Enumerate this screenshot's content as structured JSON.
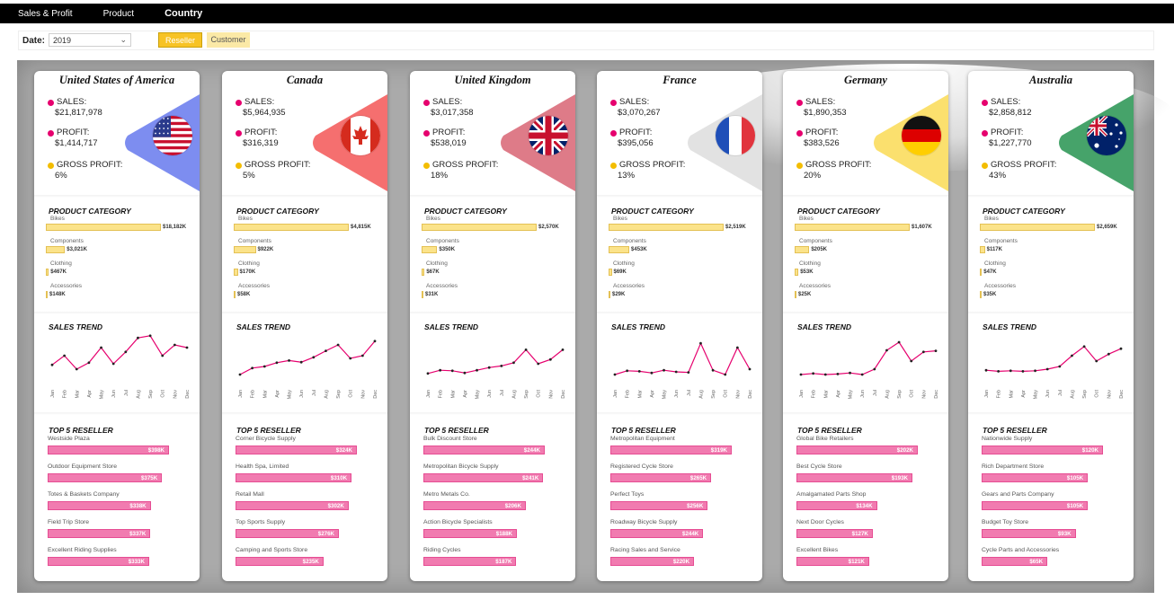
{
  "nav": {
    "tabs": [
      {
        "label": "Sales & Profit"
      },
      {
        "label": "Product"
      },
      {
        "label": "Country"
      }
    ],
    "active": "Country"
  },
  "filters": {
    "date_label": "Date:",
    "date_value": "2019",
    "reseller_label": "Reseller",
    "customer_label": "Customer"
  },
  "colors": {
    "sales_dot": "#e6006e",
    "gross_dot": "#f3bd00",
    "category_bar": "#fbe38a",
    "reseller_bar": "#f17bb0",
    "trend_line": "#e6006e"
  },
  "labels": {
    "sales": "SALES:",
    "profit": "PROFIT:",
    "gross": "GROSS PROFIT:",
    "product_category": "PRODUCT CATEGORY",
    "sales_trend": "SALES TREND",
    "top5": "TOP 5 RESELLER",
    "months": [
      "Jan",
      "Feb",
      "Mar",
      "Apr",
      "May",
      "Jun",
      "Jul",
      "Aug",
      "Sep",
      "Oct",
      "Nov",
      "Dec"
    ],
    "categories": [
      "Bikes",
      "Components",
      "Clothing",
      "Accessories"
    ]
  },
  "countries": [
    {
      "name": "United States of America",
      "flag_icon": "usa-flag-icon",
      "tri_color": "#7d8df0",
      "sales": "$21,817,978",
      "profit": "$1,414,717",
      "gross": "6%",
      "categories": [
        {
          "label": "$18,182K",
          "value": 18182
        },
        {
          "label": "$3,021K",
          "value": 3021
        },
        {
          "label": "$467K",
          "value": 467
        },
        {
          "label": "$148K",
          "value": 148
        }
      ],
      "trend": [
        38,
        55,
        30,
        42,
        70,
        40,
        62,
        88,
        92,
        55,
        75,
        70
      ],
      "resellers": [
        {
          "name": "Westside Plaza",
          "label": "$398K",
          "value": 398
        },
        {
          "name": "Outdoor Equipment Store",
          "label": "$375K",
          "value": 375
        },
        {
          "name": "Totes & Baskets Company",
          "label": "$338K",
          "value": 338
        },
        {
          "name": "Field Trip Store",
          "label": "$337K",
          "value": 337
        },
        {
          "name": "Excellent Riding Supplies",
          "label": "$333K",
          "value": 333
        }
      ]
    },
    {
      "name": "Canada",
      "flag_icon": "canada-flag-icon",
      "tri_color": "#f56f6f",
      "sales": "$5,964,935",
      "profit": "$316,319",
      "gross": "5%",
      "categories": [
        {
          "label": "$4,815K",
          "value": 4815
        },
        {
          "label": "$922K",
          "value": 922
        },
        {
          "label": "$170K",
          "value": 170
        },
        {
          "label": "$58K",
          "value": 58
        }
      ],
      "trend": [
        20,
        32,
        35,
        42,
        46,
        43,
        52,
        64,
        75,
        50,
        55,
        82
      ],
      "resellers": [
        {
          "name": "Corner Bicycle Supply",
          "label": "$324K",
          "value": 324
        },
        {
          "name": "Health Spa, Limited",
          "label": "$310K",
          "value": 310
        },
        {
          "name": "Retail Mall",
          "label": "$302K",
          "value": 302
        },
        {
          "name": "Top Sports Supply",
          "label": "$276K",
          "value": 276
        },
        {
          "name": "Camping and Sports Store",
          "label": "$235K",
          "value": 235
        }
      ]
    },
    {
      "name": "United Kingdom",
      "flag_icon": "uk-flag-icon",
      "tri_color": "#de7b88",
      "sales": "$3,017,358",
      "profit": "$538,019",
      "gross": "18%",
      "categories": [
        {
          "label": "$2,570K",
          "value": 2570
        },
        {
          "label": "$350K",
          "value": 350
        },
        {
          "label": "$67K",
          "value": 67
        },
        {
          "label": "$31K",
          "value": 31
        }
      ],
      "trend": [
        22,
        28,
        27,
        23,
        28,
        33,
        36,
        42,
        66,
        40,
        48,
        66
      ],
      "resellers": [
        {
          "name": "Bulk Discount Store",
          "label": "$244K",
          "value": 244
        },
        {
          "name": "Metropolitan Bicycle Supply",
          "label": "$241K",
          "value": 241
        },
        {
          "name": "Metro Metals Co.",
          "label": "$206K",
          "value": 206
        },
        {
          "name": "Action Bicycle Specialists",
          "label": "$188K",
          "value": 188
        },
        {
          "name": "Riding Cycles",
          "label": "$187K",
          "value": 187
        }
      ]
    },
    {
      "name": "France",
      "flag_icon": "france-flag-icon",
      "tri_color": "#e2e2e2",
      "sales": "$3,070,267",
      "profit": "$395,056",
      "gross": "13%",
      "categories": [
        {
          "label": "$2,519K",
          "value": 2519
        },
        {
          "label": "$453K",
          "value": 453
        },
        {
          "label": "$69K",
          "value": 69
        },
        {
          "label": "$29K",
          "value": 29
        }
      ],
      "trend": [
        20,
        27,
        26,
        23,
        28,
        25,
        24,
        78,
        28,
        20,
        70,
        30
      ],
      "resellers": [
        {
          "name": "Metropolitan Equipment",
          "label": "$319K",
          "value": 319
        },
        {
          "name": "Registered Cycle Store",
          "label": "$265K",
          "value": 265
        },
        {
          "name": "Perfect Toys",
          "label": "$256K",
          "value": 256
        },
        {
          "name": "Roadway Bicycle Supply",
          "label": "$244K",
          "value": 244
        },
        {
          "name": "Racing Sales and Service",
          "label": "$220K",
          "value": 220
        }
      ]
    },
    {
      "name": "Germany",
      "flag_icon": "germany-flag-icon",
      "tri_color": "#fbe06e",
      "sales": "$1,890,353",
      "profit": "$383,526",
      "gross": "20%",
      "categories": [
        {
          "label": "$1,607K",
          "value": 1607
        },
        {
          "label": "$205K",
          "value": 205
        },
        {
          "label": "$53K",
          "value": 53
        },
        {
          "label": "$25K",
          "value": 25
        }
      ],
      "trend": [
        20,
        22,
        20,
        21,
        23,
        20,
        30,
        65,
        80,
        45,
        62,
        64,
        58
      ],
      "resellers": [
        {
          "name": "Global Bike Retailers",
          "label": "$202K",
          "value": 202
        },
        {
          "name": "Best Cycle Store",
          "label": "$193K",
          "value": 193
        },
        {
          "name": "Amalgamated Parts Shop",
          "label": "$134K",
          "value": 134
        },
        {
          "name": "Next Door Cycles",
          "label": "$127K",
          "value": 127
        },
        {
          "name": "Excellent Bikes",
          "label": "$121K",
          "value": 121
        }
      ]
    },
    {
      "name": "Australia",
      "flag_icon": "australia-flag-icon",
      "tri_color": "#46a36a",
      "sales": "$2,858,812",
      "profit": "$1,227,770",
      "gross": "43%",
      "categories": [
        {
          "label": "$2,659K",
          "value": 2659
        },
        {
          "label": "$117K",
          "value": 117
        },
        {
          "label": "$47K",
          "value": 47
        },
        {
          "label": "$35K",
          "value": 35
        }
      ],
      "trend": [
        28,
        26,
        27,
        26,
        27,
        30,
        35,
        55,
        72,
        45,
        58,
        68
      ],
      "resellers": [
        {
          "name": "Nationwide Supply",
          "label": "$120K",
          "value": 120
        },
        {
          "name": "Rich Department Store",
          "label": "$105K",
          "value": 105
        },
        {
          "name": "Gears and Parts Company",
          "label": "$105K",
          "value": 105
        },
        {
          "name": "Budget Toy Store",
          "label": "$93K",
          "value": 93
        },
        {
          "name": "Cycle Parts and Accessories",
          "label": "$65K",
          "value": 65
        }
      ]
    }
  ]
}
